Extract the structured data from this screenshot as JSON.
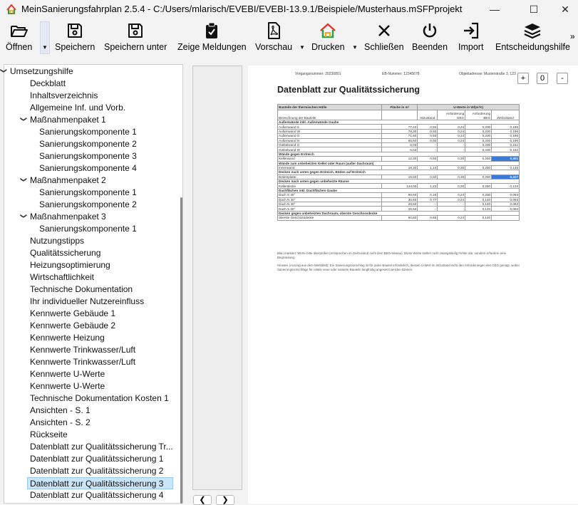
{
  "window": {
    "title": "MeinSanierungsfahrplan 2.5.4 - C:/Users/mlarisch/EVEBI/EVEBI-13.9.1/Beispiele/Musterhaus.mSFPprojekt",
    "minimize": "—",
    "maximize": "☐",
    "close": "✕"
  },
  "toolbar": {
    "open": "Öffnen",
    "save": "Speichern",
    "save_as": "Speichern unter",
    "messages": "Zeige Meldungen",
    "preview": "Vorschau",
    "print": "Drucken",
    "close": "Schließen",
    "quit": "Beenden",
    "import": "Import",
    "decision": "Entscheidungshilfe",
    "more": "»"
  },
  "tree": {
    "items": [
      {
        "label": "Umsetzungshilfe"
      },
      {
        "label": "Deckblatt"
      },
      {
        "label": "Inhaltsverzeichnis"
      },
      {
        "label": "Allgemeine Inf. und Vorb."
      },
      {
        "label": "Maßnahmenpaket 1"
      },
      {
        "label": "Sanierungskomponente 1"
      },
      {
        "label": "Sanierungskomponente 2"
      },
      {
        "label": "Sanierungskomponente 3"
      },
      {
        "label": "Sanierungskomponente 4"
      },
      {
        "label": "Maßnahmenpaket 2"
      },
      {
        "label": "Sanierungskomponente 1"
      },
      {
        "label": "Sanierungskomponente 2"
      },
      {
        "label": "Maßnahmenpaket 3"
      },
      {
        "label": "Sanierungskomponente 1"
      },
      {
        "label": "Nutzungstipps"
      },
      {
        "label": "Qualitätssicherung"
      },
      {
        "label": "Heizungsoptimierung"
      },
      {
        "label": "Wirtschaftlichkeit"
      },
      {
        "label": "Technische Dokumentation"
      },
      {
        "label": "Ihr individueller Nutzereinfluss"
      },
      {
        "label": "Kennwerte Gebäude 1"
      },
      {
        "label": "Kennwerte Gebäude 2"
      },
      {
        "label": "Kennwerte Heizung"
      },
      {
        "label": "Kennwerte Trinkwasser/Luft"
      },
      {
        "label": "Kennwerte Trinkwasser/Luft"
      },
      {
        "label": "Kennwerte U-Werte"
      },
      {
        "label": "Kennwerte U-Werte"
      },
      {
        "label": "Technische Dokumentation Kosten 1"
      },
      {
        "label": "Ansichten - S. 1"
      },
      {
        "label": "Ansichten - S. 2"
      },
      {
        "label": "Rückseite"
      },
      {
        "label": "Datenblatt zur Qualitätssicherung Tr..."
      },
      {
        "label": "Datenblatt zur Qualitätssicherung 1"
      },
      {
        "label": "Datenblatt zur Qualitätssicherung 2"
      },
      {
        "label": "Datenblatt zur Qualitätssicherung 3"
      },
      {
        "label": "Datenblatt zur Qualitätssicherung 4"
      }
    ],
    "chevron": "❯"
  },
  "nav": {
    "prev": "❮",
    "next": "❯"
  },
  "zoom": {
    "plus": "+",
    "value": "0",
    "minus": "-"
  },
  "document": {
    "meta_left": "Vorgangsnummer: 20230801",
    "meta_mid": "EB-Nummer: 12345678",
    "meta_right": "Objektadresse: Musterstraße 3, 12345 Musterstadt",
    "title": "Datenblatt zur Qualitätssicherung",
    "table": {
      "h_part": "Bauteile der thermischen Hülle",
      "h_area": "Fläche in m²",
      "h_u": "U-Werte in W/(m²K)",
      "sub_name": "Bezeichnung der Bauteile",
      "sub_ist": "Istzustand",
      "sub_anf1": "Anforderung GEG",
      "sub_anf2": "Anforderung BEG",
      "sub_ziel": "Zielzustand",
      "groups": [
        {
          "title": "Außenwände inkl. Außenwände Gaube",
          "rows": [
            [
              "Außenwand S",
              "77,40",
              "0,93",
              "0,24",
              "0,200",
              "0,196",
              ""
            ],
            [
              "Außenwand W",
              "78,30",
              "0,93",
              "0,24",
              "0,200",
              "0,196",
              ""
            ],
            [
              "Außenwand O",
              "71,50",
              "0,93",
              "0,24",
              "0,200",
              "0,196",
              ""
            ],
            [
              "Außenwand N",
              "65,60",
              "0,93",
              "0,24",
              "0,200",
              "0,196",
              ""
            ],
            [
              "Giebelwand O",
              "6,03",
              "-",
              "-",
              "0,200",
              "0,152",
              ""
            ],
            [
              "Giebelwand W",
              "6,03",
              "-",
              "-",
              "0,200",
              "0,152",
              ""
            ]
          ]
        },
        {
          "title": "Wände gegen Erdreich",
          "rows": [
            [
              "Kellerwand",
              "12,30",
              "0,50",
              "0,30",
              "0,250",
              "0,301",
              "hl"
            ]
          ]
        },
        {
          "title": "Wände zum unbeheizten Keller oder Raum (außer Dachraum)",
          "rows": [
            [
              "Innenwand",
              "18,30",
              "1,14",
              "0,30",
              "0,250",
              "0,145",
              ""
            ]
          ]
        },
        {
          "title": "Decken nach unten gegen Erdreich, Böden auf Erdreich",
          "rows": [
            [
              "Bodenplatte",
              "15,50",
              "0,93",
              "0,30",
              "0,250",
              "0,327",
              "hl"
            ]
          ]
        },
        {
          "title": "Decken nach unten gegen unbeheizte Räume",
          "rows": [
            [
              "Kellerdecke",
              "144,00",
              "1,23",
              "0,30",
              "0,250",
              "0,133",
              ""
            ]
          ]
        },
        {
          "title": "Dachflächen inkl. Dachflächen Gaube",
          "rows": [
            [
              "Dach S 30°",
              "90,60",
              "0,18",
              "0,24",
              "0,200",
              "0,093",
              ""
            ],
            [
              "Dach N 30°",
              "30,60",
              "0,77",
              "0,24",
              "0,140",
              "0,093",
              ""
            ],
            [
              "Dach N 30°",
              "26,50",
              "-",
              "-",
              "0,140",
              "0,093",
              ""
            ],
            [
              "Dach S 30°",
              "26,50",
              "-",
              "-",
              "0,140",
              "0,093",
              ""
            ]
          ]
        },
        {
          "title": "Decken gegen unbeheizten Dachraum, oberste Geschossdecke",
          "rows": [
            [
              "oberste Geschossdecke",
              "60,60",
              "0,65",
              "0,24",
              "0,140",
              "",
              ""
            ]
          ]
        }
      ]
    },
    "note1": "Blau markiert: Werte bitte überprüfen (entsprechen im Zielzustand nicht dem BEG-Niveau). Diese Werte stellen nicht zwangsläufig Fehler dar, sondern erfordern eine Begründung.",
    "note2": "Hinweis (Auszug aus dem Merkblatt): Ein Sanierungsvorschlag ist für jedes Bauteil erforderlich, dessen U-Wert im Istzustand nicht den Anforderungen des GEG genügt, wobei Sanierungsvorschläge für relativ neue oder sanierte Bauteile langfristig angesetzt werden können."
  },
  "colors": {
    "accent": "#3b7ad9",
    "selected_bg": "#cce4f7"
  }
}
